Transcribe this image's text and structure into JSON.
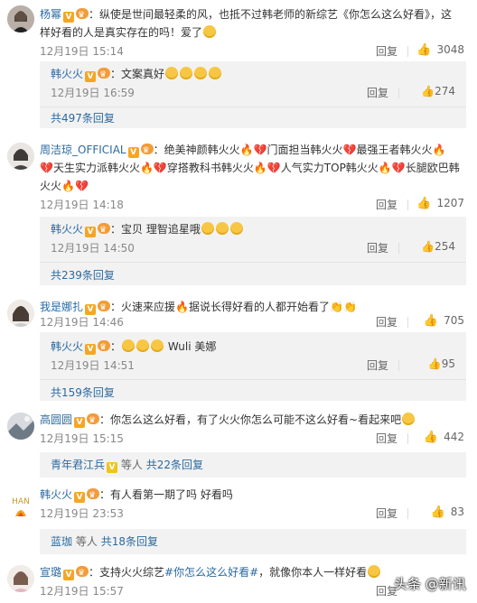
{
  "comments": [
    {
      "user": "杨幂",
      "text_a": "：纵使是世间最轻柔的风，也抵不过韩老师的新综艺《你怎么这么好看》，这",
      "text_b": "样好看的人是真实存在的吗！爱了",
      "time": "12月19日 15:14",
      "reply": "回复",
      "likes": "3048",
      "sub": {
        "user": "韩火火",
        "text": "：文案真好",
        "time": "12月19日 16:59",
        "reply": "回复",
        "likes": "274"
      },
      "more": "共497条回复"
    },
    {
      "user": "周洁琼_OFFICIAL",
      "line1": "：绝美神颜韩火火",
      "line1b": "门面担当韩火火",
      "line1c": "最强王者韩火火",
      "line2a": "天生实力派韩火火",
      "line2b": "穿搭教科书韩火火",
      "line2c": "人气实力TOP韩火火",
      "line2d": "长腿欧巴韩",
      "line3": "火火",
      "time": "12月19日 14:18",
      "reply": "回复",
      "likes": "1207",
      "sub": {
        "user": "韩火火",
        "text": "：宝贝 理智追星哦",
        "time": "12月19日 14:50",
        "reply": "回复",
        "likes": "254"
      },
      "more": "共239条回复"
    },
    {
      "user": "我是娜扎",
      "text_a": "：火速来应援",
      "text_b": "据说长得好看的人都开始看了",
      "time": "12月19日 14:46",
      "reply": "回复",
      "likes": "705",
      "sub": {
        "user": "韩火火",
        "text": "Wuli 美娜",
        "time": "12月19日 14:51",
        "reply": "回复",
        "likes": "95"
      },
      "more": "共159条回复"
    },
    {
      "user": "高圆圆",
      "text": "：你怎么这么好看，有了火火你怎么可能不这么好看~看起来吧",
      "time": "12月19日 15:15",
      "reply": "回复",
      "likes": "442",
      "more_users": "青年君江兵",
      "more_mid": "等人",
      "more_count": "共22条回复"
    },
    {
      "user": "韩火火",
      "text": "：有人看第一期了吗 好看吗",
      "time": "12月19日 23:53",
      "reply": "回复",
      "likes": "83",
      "more_users": "蓝珈",
      "more_mid": "等人",
      "more_count": "共18条回复"
    },
    {
      "user": "宣璐",
      "text_a": "：支持火火综艺",
      "tag": "#你怎么这么好看#",
      "text_b": "，就像你本人一样好看",
      "time": "12月19日 15:57",
      "reply": "回复"
    }
  ],
  "watermark": "头条 @新讯",
  "avatar_labels": {
    "han": "HAN"
  },
  "badge": "V"
}
